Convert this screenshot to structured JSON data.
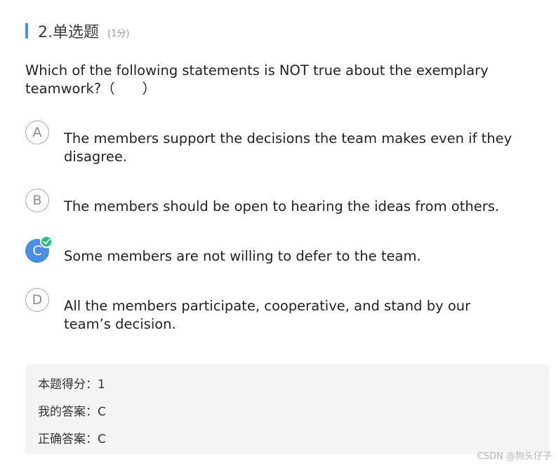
{
  "question": {
    "title": "2.单选题",
    "score": "(1分)",
    "stem": "Which of the following statements is NOT true about the exemplary teamwork?（　　）"
  },
  "options": [
    {
      "letter": "A",
      "text": "The members support the decisions the team makes even if they disagree."
    },
    {
      "letter": "B",
      "text": "The members should be open to hearing the ideas from others."
    },
    {
      "letter": "C",
      "text": "Some members are not willing to defer to the team."
    },
    {
      "letter": "D",
      "text": "All the members participate, cooperative, and stand by our team’s decision."
    }
  ],
  "selected_option": "C",
  "summary": {
    "score_line": "本题得分：1",
    "my_answer_line": "我的答案：C",
    "correct_answer_line": "正确答案：C"
  },
  "watermark": "CSDN @狗头仔子",
  "colors": {
    "accent": "#4a8fe7",
    "correct": "#1ec27a"
  }
}
